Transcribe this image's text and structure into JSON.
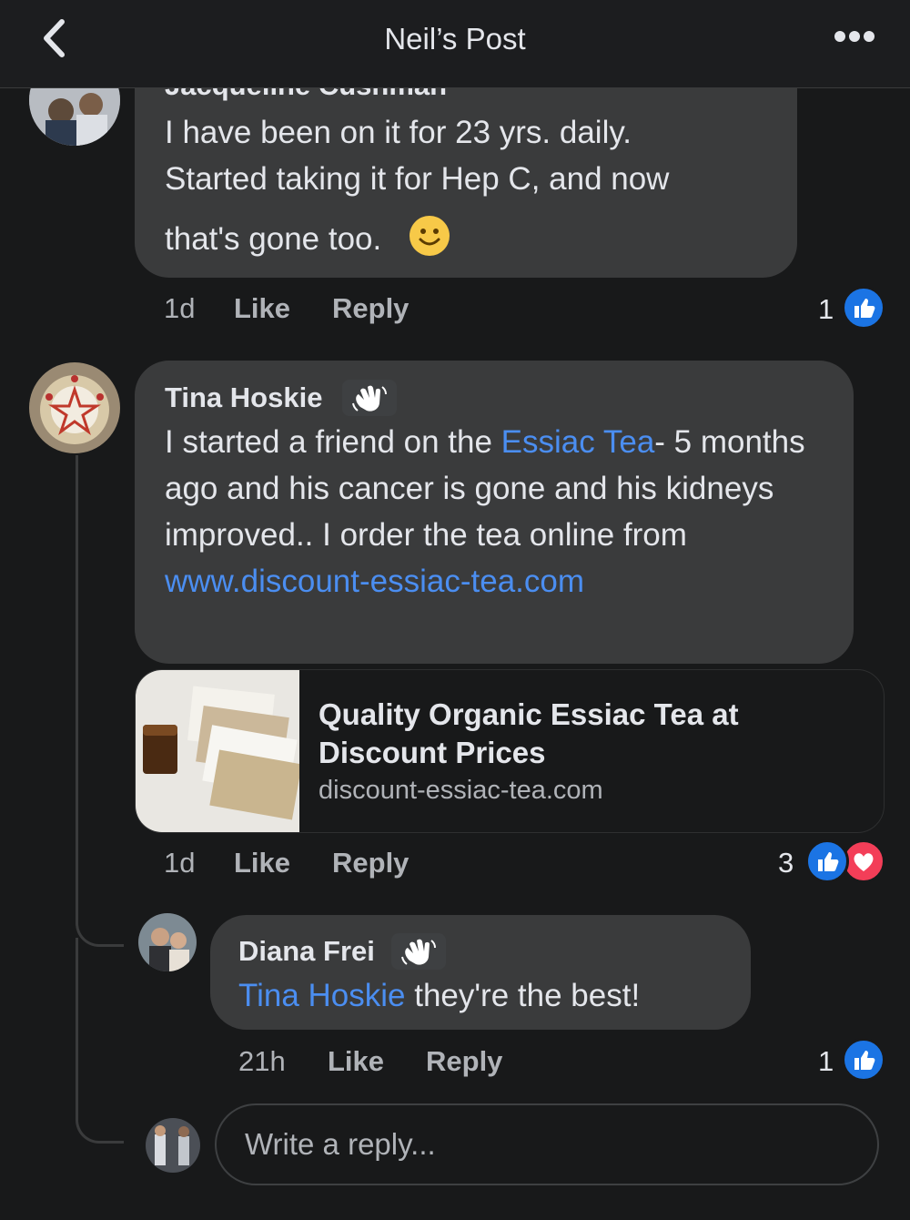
{
  "header": {
    "title": "Neil’s Post"
  },
  "comments": [
    {
      "author": "Jacqueline Cushman",
      "line1": "I have been on it for 23 yrs. daily.",
      "line2": "Started taking it for Hep C, and now",
      "line3": "that's gone too.",
      "emoji": "🙂",
      "time": "1d",
      "like": "Like",
      "reply": "Reply",
      "reactions": "1"
    },
    {
      "author": "Tina Hoskie",
      "text_pre": "I started a friend on the ",
      "link1": "Essiac Tea",
      "text_mid": "- 5 months ago and his cancer is gone and his kidneys improved.. I order the tea online from ",
      "link2": "www.discount-essiac-tea.com",
      "preview": {
        "title": "Quality Organic Essiac Tea at Discount Prices",
        "domain": "discount-essiac-tea.com"
      },
      "time": "1d",
      "like": "Like",
      "reply": "Reply",
      "reactions": "3"
    }
  ],
  "reply": {
    "author": "Diana Frei",
    "mention": "Tina Hoskie",
    "text": " they're the best!",
    "time": "21h",
    "like": "Like",
    "reply": "Reply",
    "reactions": "1"
  },
  "composer": {
    "placeholder": "Write a reply..."
  },
  "colors": {
    "background": "#18191a",
    "bubble": "#3a3b3c",
    "link": "#4b8ef1",
    "like": "#1b74e4",
    "love": "#f33e58"
  }
}
